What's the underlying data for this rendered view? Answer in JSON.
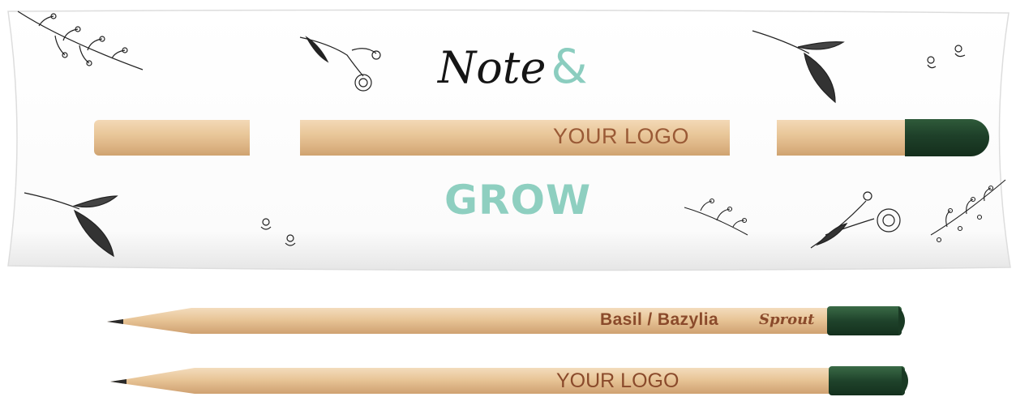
{
  "sleeve": {
    "title": "Note",
    "ampersand": "&",
    "subtitle": "GROW",
    "logo_text": "YOUR LOGO",
    "accent_color": "#8ecfc0",
    "cap_color": "#1e4029"
  },
  "pencils": [
    {
      "text": "Basil / Bazylia",
      "brand": "Sprout"
    },
    {
      "text": "YOUR LOGO"
    }
  ],
  "icons": [
    "leaf-icon",
    "flower-icon",
    "branch-icon"
  ]
}
